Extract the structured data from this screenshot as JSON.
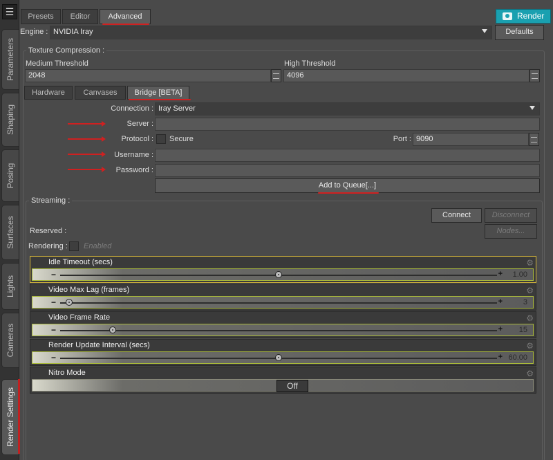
{
  "rail": {
    "tabs": [
      {
        "label": "Parameters"
      },
      {
        "label": "Shaping"
      },
      {
        "label": "Posing"
      },
      {
        "label": "Surfaces"
      },
      {
        "label": "Lights"
      },
      {
        "label": "Cameras"
      },
      {
        "label": "Render Settings"
      }
    ]
  },
  "top_tabs": [
    "Presets",
    "Editor",
    "Advanced"
  ],
  "render_label": "Render",
  "engine": {
    "label": "Engine :",
    "value": "NVIDIA Iray",
    "defaults_label": "Defaults"
  },
  "texture_compression": {
    "title": "Texture Compression :",
    "medium_label": "Medium Threshold",
    "medium_value": "2048",
    "high_label": "High Threshold",
    "high_value": "4096"
  },
  "sub_tabs": [
    "Hardware",
    "Canvases",
    "Bridge [BETA]"
  ],
  "bridge": {
    "connection_label": "Connection :",
    "connection_value": "Iray Server",
    "server_label": "Server :",
    "server_value": "",
    "protocol_label": "Protocol :",
    "secure_label": "Secure",
    "port_label": "Port :",
    "port_value": "9090",
    "username_label": "Username :",
    "username_value": "",
    "password_label": "Password :",
    "password_value": "",
    "add_to_queue_label": "Add to Queue[...]"
  },
  "streaming": {
    "title": "Streaming :",
    "connect_label": "Connect",
    "disconnect_label": "Disconnect",
    "nodes_label": "Nodes...",
    "reserved_label": "Reserved :",
    "rendering_label": "Rendering :",
    "enabled_label": "Enabled"
  },
  "sliders": [
    {
      "name": "Idle Timeout (secs)",
      "value": "1.00",
      "position": 0.5
    },
    {
      "name": "Video Max Lag (frames)",
      "value": "3",
      "position": 0.02
    },
    {
      "name": "Video Frame Rate",
      "value": "15",
      "position": 0.12
    },
    {
      "name": "Render Update Interval (secs)",
      "value": "60.00",
      "position": 0.5
    }
  ],
  "nitro": {
    "name": "Nitro Mode",
    "value": "Off"
  },
  "colors": {
    "accent": "#1aa0b0",
    "marker": "#d02020",
    "selection": "#d4b53a"
  }
}
